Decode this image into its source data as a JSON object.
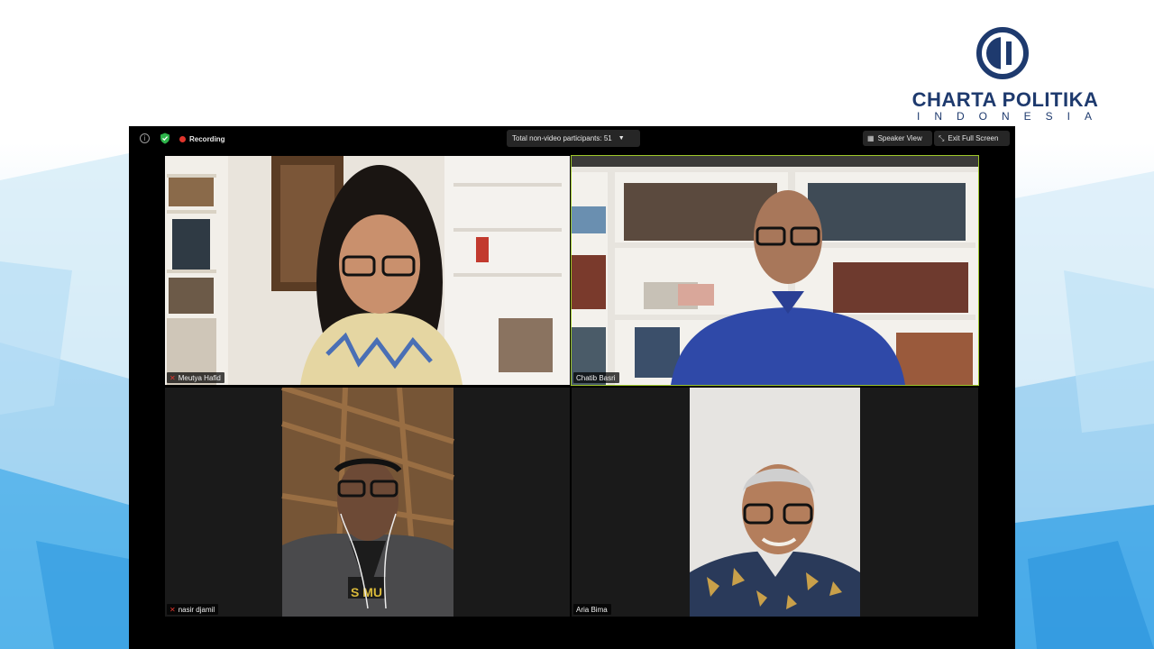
{
  "branding": {
    "title": "CHARTA POLITIKA",
    "subtitle": "INDONESIA",
    "logo_icon": "charta-politika-logo",
    "color": "#1e3a6e"
  },
  "toolbar": {
    "info_icon": "info-icon",
    "security_icon": "shield-icon",
    "recording_label": "Recording",
    "participants_label": "Total non-video participants: 51",
    "speaker_view_label": "Speaker View",
    "exit_full_screen_label": "Exit Full Screen",
    "recording_color": "#e0352c"
  },
  "participants": [
    {
      "name": "Meutya Hafid",
      "muted": true,
      "active": false
    },
    {
      "name": "Chatib Basri",
      "muted": false,
      "active": true
    },
    {
      "name": "nasir djamil",
      "muted": true,
      "active": false
    },
    {
      "name": "Aria Bima",
      "muted": false,
      "active": false
    }
  ],
  "colors": {
    "active_speaker": "#9ec62a",
    "window_bg": "#000000"
  }
}
